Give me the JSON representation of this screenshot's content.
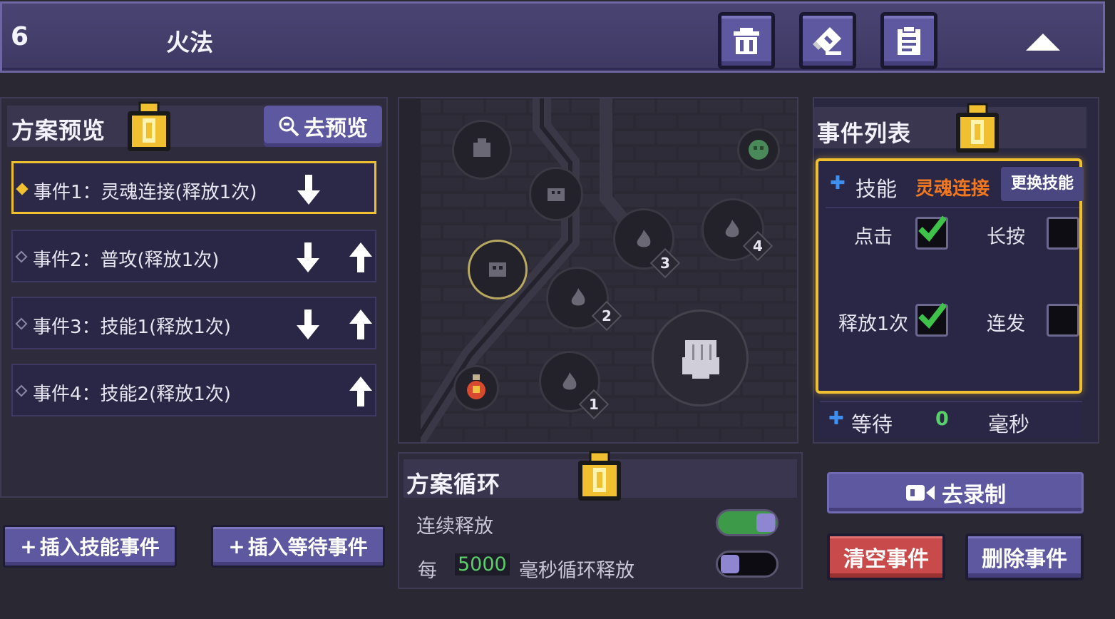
{
  "header": {
    "slot_number": "6",
    "plan_name": "火法",
    "icons": [
      "trash-icon",
      "eraser-icon",
      "clipboard-icon",
      "collapse-triangle-icon"
    ]
  },
  "preview": {
    "title": "方案预览",
    "go_preview_label": "去预览",
    "lock_icon": "lock-icon"
  },
  "events": [
    {
      "label": "事件1：灵魂连接(释放1次)",
      "selected": true,
      "down": true,
      "up": false
    },
    {
      "label": "事件2：普攻(释放1次)",
      "selected": false,
      "down": true,
      "up": true
    },
    {
      "label": "事件3：技能1(释放1次)",
      "selected": false,
      "down": true,
      "up": true
    },
    {
      "label": "事件4：技能2(释放1次)",
      "selected": false,
      "down": false,
      "up": true
    }
  ],
  "insert_buttons": {
    "skill_event": "插入技能事件",
    "wait_event": "插入等待事件"
  },
  "map": {
    "skill_slot_numbers": [
      "1",
      "2",
      "3",
      "4"
    ]
  },
  "loop": {
    "title": "方案循环",
    "continuous_label": "连续释放",
    "continuous_on": true,
    "every_prefix": "每",
    "interval_value": "5000",
    "interval_suffix": "毫秒循环释放",
    "interval_on": false
  },
  "event_list": {
    "title": "事件列表",
    "skill_label": "技能",
    "skill_name": "灵魂连接",
    "change_skill_label": "更换技能",
    "click_label": "点击",
    "click_checked": true,
    "long_press_label": "长按",
    "long_press_checked": false,
    "release_once_label": "释放1次",
    "release_once_checked": true,
    "burst_label": "连发",
    "burst_checked": false,
    "wait_label": "等待",
    "wait_value": "0",
    "wait_unit": "毫秒"
  },
  "actions": {
    "record_label": "去录制",
    "clear_label": "清空事件",
    "delete_label": "删除事件"
  },
  "colors": {
    "accent_gold": "#f0c030",
    "button_purple": "#5e58a0",
    "danger_red": "#c84a4a",
    "skill_orange": "#f07820",
    "value_green": "#5ad06a"
  }
}
